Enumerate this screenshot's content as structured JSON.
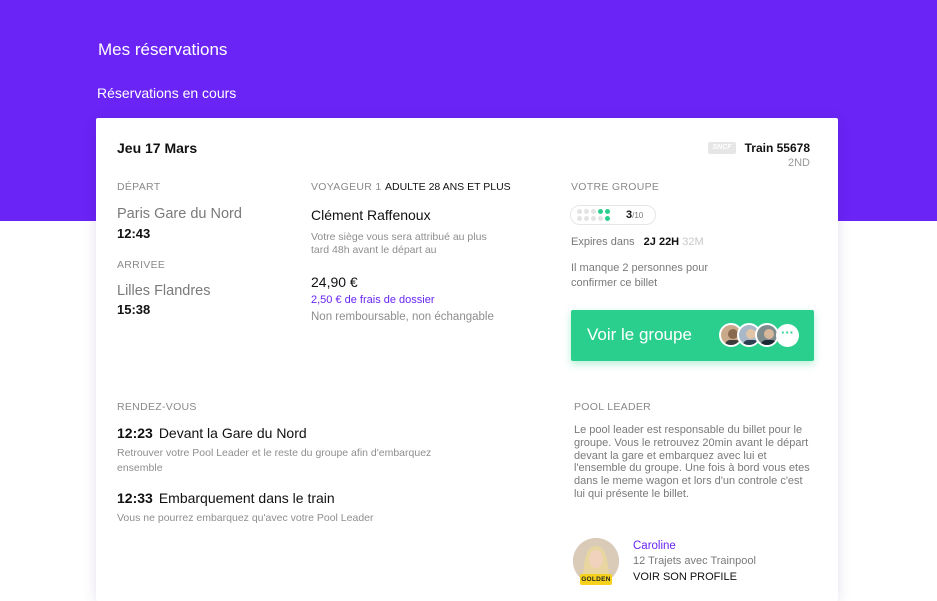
{
  "header": {
    "title": "Mes réservations",
    "section": "Réservations en cours",
    "color": "#6a24f5"
  },
  "booking": {
    "date": "Jeu 17 Mars",
    "logo": "SNCF",
    "train": "Train 55678",
    "class": "2ND",
    "departure": {
      "label": "DÉPART",
      "station": "Paris Gare du Nord",
      "time": "12:43"
    },
    "arrival": {
      "label": "ARRIVEE",
      "station": "Lilles Flandres",
      "time": "15:38"
    },
    "traveler": {
      "label": "VOYAGEUR 1",
      "type": "ADULTE 28 ANS ET PLUS",
      "name": "Clément Raffenoux",
      "seat_note": "Votre siège vous sera attribué au plus tard 48h avant le départ au",
      "price": "24,90 €",
      "fee": "2,50 € de frais de dossier",
      "conditions": "Non remboursable, non échangable"
    },
    "group": {
      "label": "VOTRE GROUPE",
      "count": "3",
      "total": "/10",
      "filled_fraction": 0.3,
      "expires_label": "Expires dans",
      "expires_value": "2J 22H",
      "expires_faded": "32M",
      "missing": "Il manque 2 personnes pour confirmer ce billet",
      "button_label": "Voir le groupe",
      "more_icon": "···",
      "accent": "#2bcf8d"
    },
    "meeting": {
      "label": "RENDEZ-VOUS",
      "items": [
        {
          "time": "12:23",
          "title": "Devant la Gare du Nord",
          "desc": "Retrouver votre Pool Leader et le reste du groupe afin d'embarquez ensemble"
        },
        {
          "time": "12:33",
          "title": "Embarquement dans le train",
          "desc": "Vous ne pourrez embarquez qu'avec votre Pool Leader"
        }
      ]
    },
    "pool_leader": {
      "label": "POOL LEADER",
      "description": "Le pool leader est responsable du billet pour le groupe. Vous le retrouvez 20min avant le départ devant la gare et embarquez avec lui et l'ensemble du groupe. Une fois à bord vous etes dans le meme wagon et lors d'un controle c'est lui qui présente le billet.",
      "name": "Caroline",
      "trips": "12 Trajets avec Trainpool",
      "link": "VOIR SON PROFILE",
      "badge": "GOLDEN"
    }
  }
}
